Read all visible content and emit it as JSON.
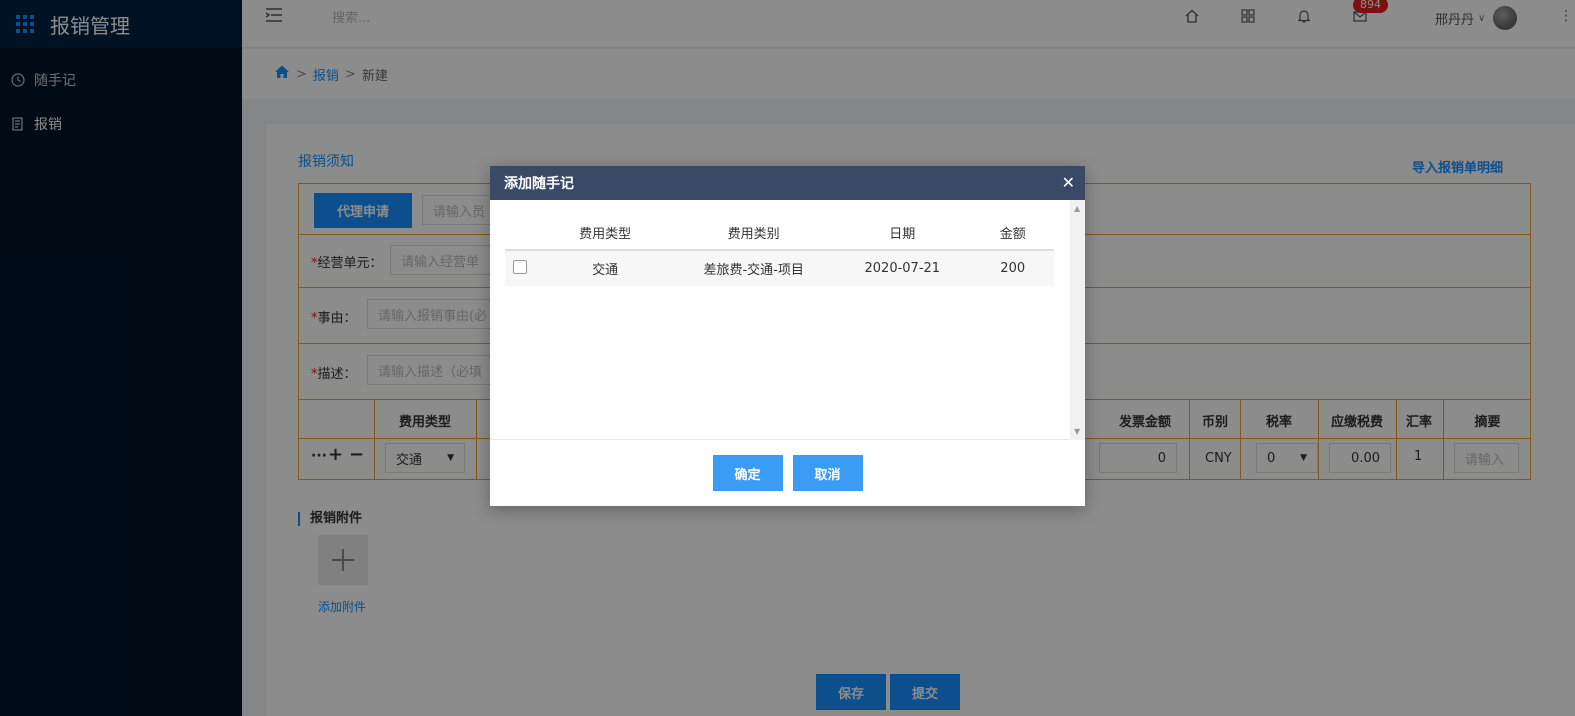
{
  "app": {
    "title": "报销管理"
  },
  "sidebar": {
    "items": [
      {
        "label": "随手记",
        "icon": "clock-note-icon"
      },
      {
        "label": "报销",
        "icon": "receipt-icon"
      }
    ]
  },
  "header": {
    "search_placeholder": "搜索...",
    "badge_count": "894",
    "user_name": "邢丹丹"
  },
  "breadcrumb": {
    "items": [
      {
        "label": "报销"
      },
      {
        "label": "新建"
      }
    ],
    "separator": ">"
  },
  "form": {
    "notice_title": "报销须知",
    "import_link": "导入报销单明细",
    "agent_button": "代理申请",
    "applicant_placeholder": "请输入员",
    "unit_label": "经营单元：",
    "unit_placeholder": "请输入经营单",
    "reason_label": "事由：",
    "reason_placeholder": "请输入报销事由(必",
    "desc_label": "描述：",
    "desc_placeholder": "请输入描述（必填",
    "required_mark": "*"
  },
  "detail_table": {
    "headers": {
      "expense_type": "费用类型",
      "invoice_amount": "发票金额",
      "currency": "币别",
      "tax_rate": "税率",
      "tax_payable": "应缴税费",
      "exchange_rate": "汇率",
      "summary": "摘要"
    },
    "row": {
      "expense_type": "交通",
      "invoice_amount": "0",
      "currency": "CNY",
      "tax_rate": "0",
      "tax_payable": "0.00",
      "exchange_rate": "1",
      "summary_placeholder": "请输入"
    }
  },
  "attachments": {
    "title": "报销附件",
    "add_label": "添加附件"
  },
  "actions": {
    "save": "保存",
    "submit": "提交"
  },
  "modal": {
    "title": "添加随手记",
    "columns": [
      "费用类型",
      "费用类别",
      "日期",
      "金额"
    ],
    "rows": [
      {
        "type": "交通",
        "category": "差旅费-交通-项目",
        "date": "2020-07-21",
        "amount": "200",
        "checked": false
      }
    ],
    "confirm": "确定",
    "cancel": "取消"
  }
}
